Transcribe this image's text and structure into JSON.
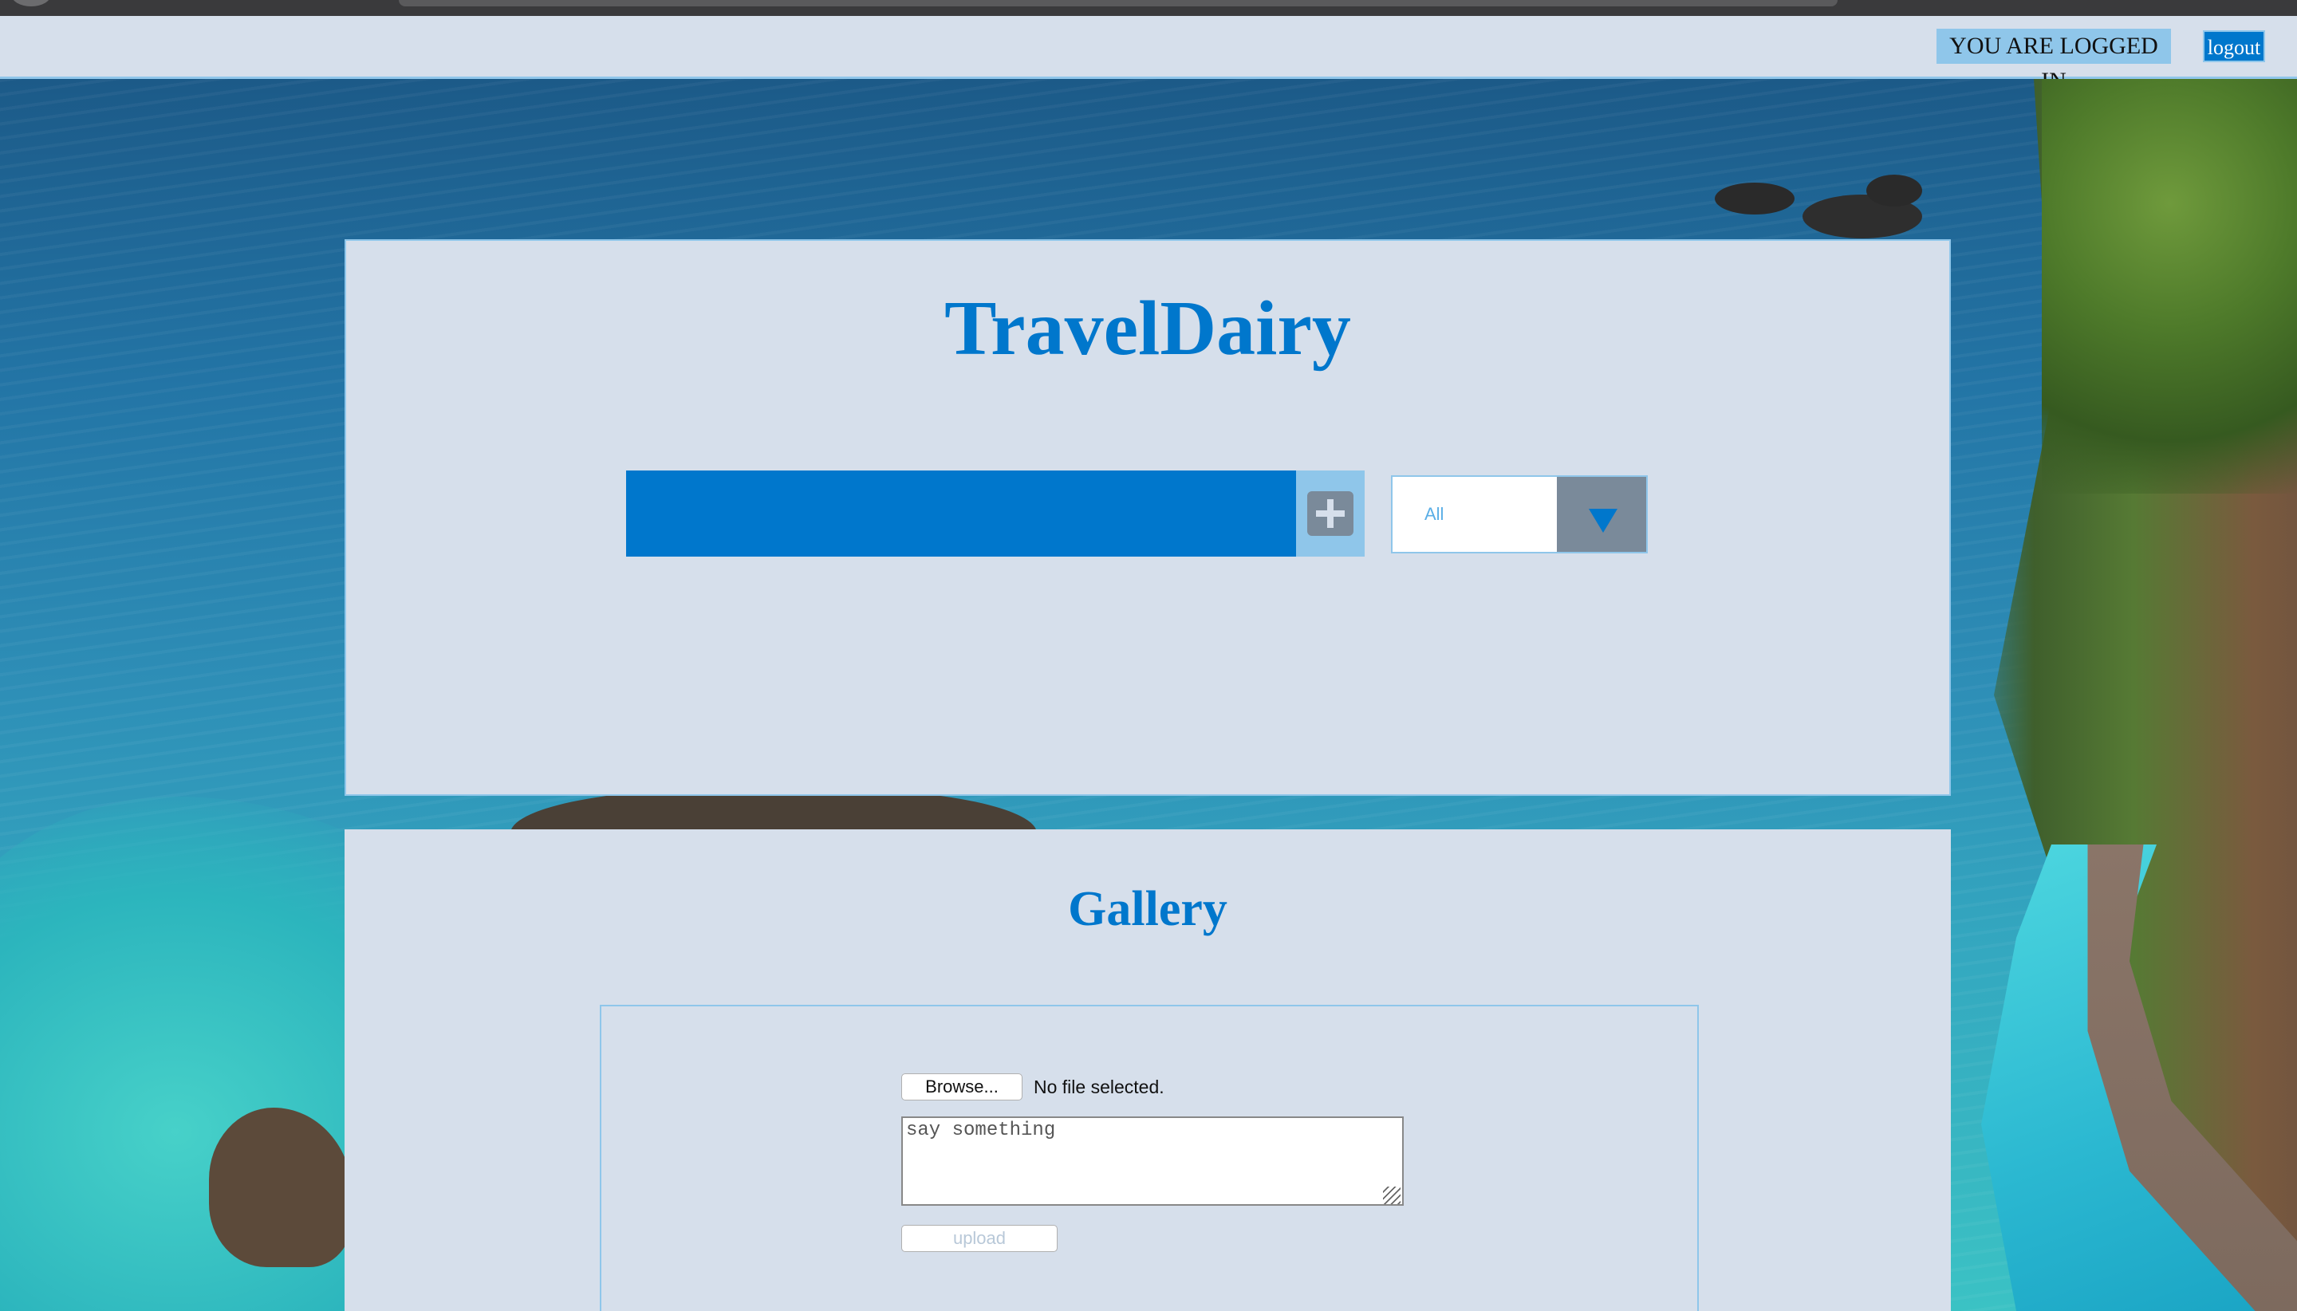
{
  "topbar": {
    "status_text": "YOU ARE LOGGED IN",
    "logout_label": "logout"
  },
  "main": {
    "title": "TravelDairy",
    "new_entry": {
      "value": "",
      "add_icon": "plus-icon"
    },
    "filter": {
      "selected": "All",
      "arrow_icon": "triangle-down-icon"
    }
  },
  "gallery": {
    "title": "Gallery",
    "browse_label": "Browse...",
    "file_status": "No file selected.",
    "caption_placeholder": "say something",
    "upload_label": "upload"
  },
  "colors": {
    "accent": "#0077cc",
    "accent_light": "#8fc6ea",
    "panel_bg": "#d6dfeb",
    "control_gray": "#7a8a9a"
  }
}
